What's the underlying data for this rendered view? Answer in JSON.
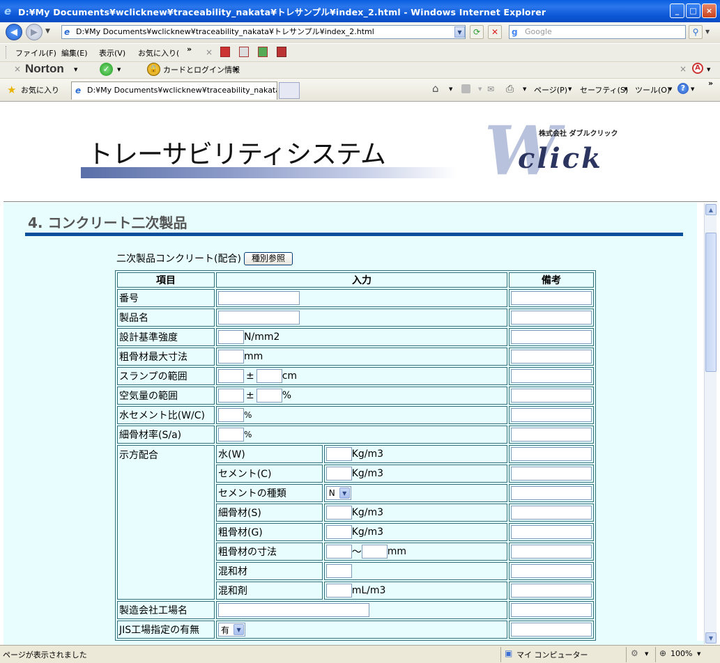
{
  "window": {
    "title": "D:¥My Documents¥wclicknew¥traceability_nakata¥トレサンプル¥index_2.html - Windows Internet Explorer",
    "controls": [
      "_",
      "□",
      "×"
    ]
  },
  "address_bar": {
    "url": "D:¥My Documents¥wclicknew¥traceability_nakata¥トレサンプル¥index_2.html",
    "search_placeholder": "Google"
  },
  "menu": [
    "ファイル(F)",
    "編集(E)",
    "表示(V)",
    "お気に入り(",
    "»"
  ],
  "norton_bar": {
    "brand": "Norton",
    "card_login": "カードとログイン情報"
  },
  "favorites": {
    "label": "お気に入り",
    "tab_title": "D:¥My Documents¥wclicknew¥traceability_nakata¥..."
  },
  "command_bar": {
    "page": "ページ(P)",
    "safety": "セーフティ(S)",
    "tools": "ツール(O)"
  },
  "header": {
    "system_title": "トレーサビリティシステム",
    "company": "株式会社 ダブルクリック",
    "logo_text": "click",
    "logo_mark": "W"
  },
  "section": {
    "title": "4. コンクリート二次製品"
  },
  "form": {
    "caption": "二次製品コンクリート(配合)",
    "type_button": "種別参照",
    "headers": {
      "item": "項目",
      "input": "入力",
      "notes": "備考"
    },
    "rows": {
      "number": "番号",
      "product_name": "製品名",
      "design_strength": "設計基準強度",
      "design_strength_unit": "N/mm2",
      "max_aggregate": "粗骨材最大寸法",
      "max_aggregate_unit": "mm",
      "slump": "スランプの範囲",
      "slump_pm": "±",
      "slump_unit": "cm",
      "air": "空気量の範囲",
      "air_pm": "±",
      "air_unit": "%",
      "wc_ratio": "水セメント比(W/C)",
      "wc_unit": "%",
      "sa_ratio": "細骨材率(S/a)",
      "sa_unit": "%",
      "mix": "示方配合",
      "water": "水(W)",
      "cement": "セメント(C)",
      "cement_type": "セメントの種類",
      "cement_type_value": "N",
      "fine_agg": "細骨材(S)",
      "coarse_agg": "粗骨材(G)",
      "coarse_size": "粗骨材の寸法",
      "range_sep": "～",
      "admixture_material": "混和材",
      "admixture_agent": "混和剤",
      "unit_kg": "Kg/m3",
      "unit_ml": "mL/m3",
      "size_unit": "mm",
      "factory": "製造会社工場名",
      "jis": "JIS工場指定の有無",
      "jis_value": "有"
    }
  },
  "status_bar": {
    "message": "ページが表示されました",
    "zone": "マイ コンピューター",
    "zoom": "100%"
  }
}
